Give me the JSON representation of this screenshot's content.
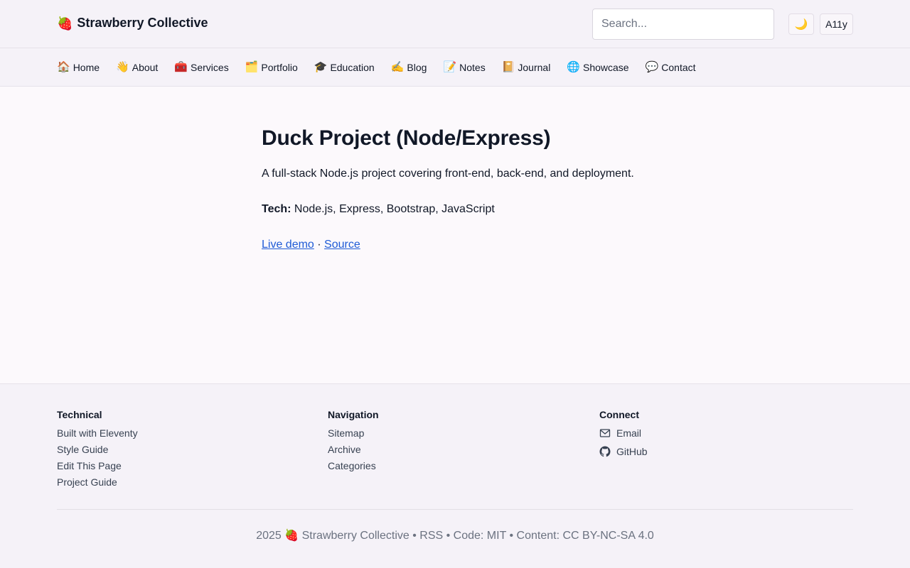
{
  "header": {
    "brand_icon": "🍓",
    "brand_name": "Strawberry Collective",
    "search_placeholder": "Search...",
    "theme_icon": "🌙",
    "a11y_label": "A11y"
  },
  "nav": {
    "items": [
      {
        "icon": "🏠",
        "label": "Home"
      },
      {
        "icon": "👋",
        "label": "About"
      },
      {
        "icon": "🧰",
        "label": "Services"
      },
      {
        "icon": "🗂️",
        "label": "Portfolio"
      },
      {
        "icon": "🎓",
        "label": "Education"
      },
      {
        "icon": "✍️",
        "label": "Blog"
      },
      {
        "icon": "📝",
        "label": "Notes"
      },
      {
        "icon": "📔",
        "label": "Journal"
      },
      {
        "icon": "🌐",
        "label": "Showcase"
      },
      {
        "icon": "💬",
        "label": "Contact"
      }
    ]
  },
  "main": {
    "title": "Duck Project (Node/Express)",
    "description": "A full-stack Node.js project covering front-end, back-end, and deployment.",
    "tech_label": "Tech:",
    "tech_value": " Node.js, Express, Bootstrap, JavaScript",
    "live_demo": "Live demo",
    "separator": " · ",
    "source": "Source"
  },
  "footer": {
    "technical": {
      "heading": "Technical",
      "links": [
        "Built with Eleventy",
        "Style Guide",
        "Edit This Page",
        "Project Guide"
      ]
    },
    "navigation": {
      "heading": "Navigation",
      "links": [
        "Sitemap",
        "Archive",
        "Categories"
      ]
    },
    "connect": {
      "heading": "Connect",
      "email": "Email",
      "github": "GitHub"
    },
    "copyright": {
      "year": "2025",
      "icon": "🍓",
      "text": "Strawberry Collective • RSS • Code: MIT • Content: CC BY-NC-SA 4.0"
    }
  }
}
